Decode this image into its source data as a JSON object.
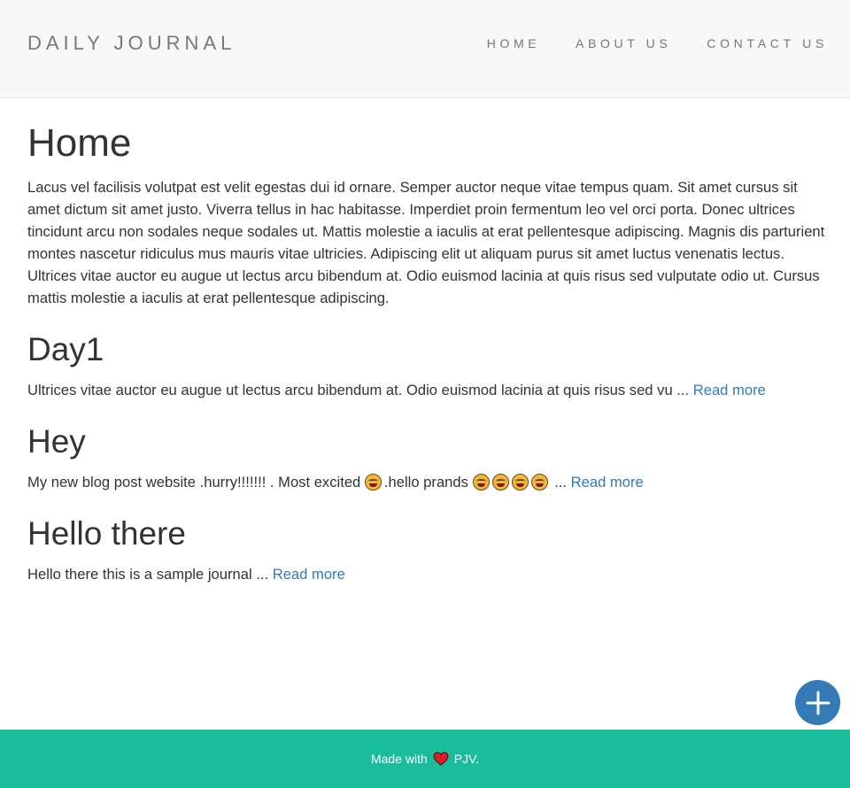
{
  "navbar": {
    "brand": "DAILY JOURNAL",
    "links": [
      {
        "label": "HOME"
      },
      {
        "label": "ABOUT US"
      },
      {
        "label": "CONTACT US"
      }
    ]
  },
  "home": {
    "title": "Home",
    "intro": "Lacus vel facilisis volutpat est velit egestas dui id ornare. Semper auctor neque vitae tempus quam. Sit amet cursus sit amet dictum sit amet justo. Viverra tellus in hac habitasse. Imperdiet proin fermentum leo vel orci porta. Donec ultrices tincidunt arcu non sodales neque sodales ut. Mattis molestie a iaculis at erat pellentesque adipiscing. Magnis dis parturient montes nascetur ridiculus mus mauris vitae ultricies. Adipiscing elit ut aliquam purus sit amet luctus venenatis lectus. Ultrices vitae auctor eu augue ut lectus arcu bibendum at. Odio euismod lacinia at quis risus sed vulputate odio ut. Cursus mattis molestie a iaculis at erat pellentesque adipiscing."
  },
  "posts": [
    {
      "title": "Day1",
      "excerpt": "Ultrices vitae auctor eu augue ut lectus arcu bibendum at. Odio euismod lacinia at quis risus sed vu ...",
      "read_more": "Read more"
    },
    {
      "title": "Hey",
      "excerpt_part1": "My new blog post website .hurry!!!!!!! . Most excited",
      "excerpt_part2": ".hello prands",
      "excerpt_part3": "...",
      "read_more": "Read more"
    },
    {
      "title": "Hello there",
      "excerpt": "Hello there this is a sample journal ...",
      "read_more": "Read more"
    }
  ],
  "compose_button": {
    "icon": "plus-icon"
  },
  "footer": {
    "text_before": "Made with",
    "text_after": "PJV."
  },
  "colors": {
    "navbar_bg": "#f8f8f8",
    "link": "#337ab7",
    "footer_bg": "#1abc9c",
    "fab_bg": "#337ab7",
    "heart": "#e31b23"
  }
}
